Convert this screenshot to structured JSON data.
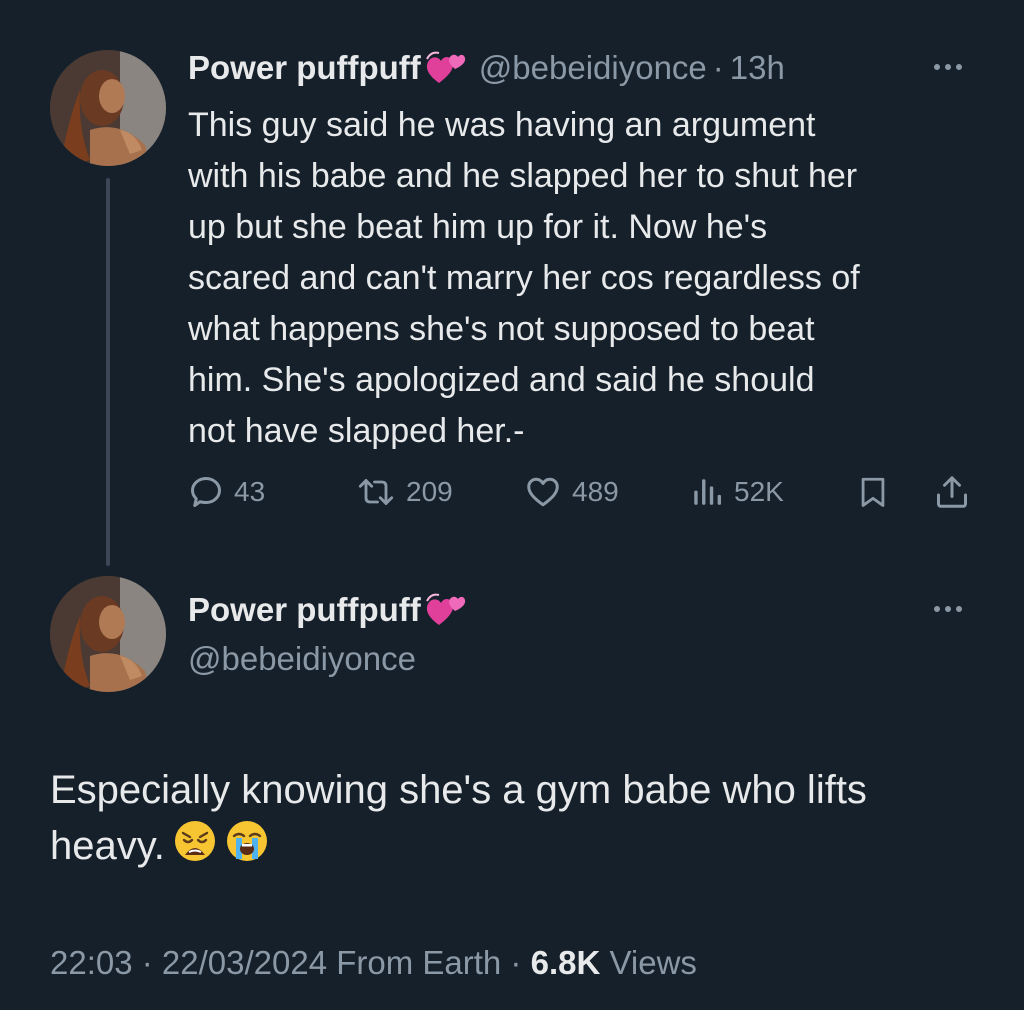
{
  "tweet1": {
    "avatar": "profile-photo",
    "name": "Power puffpuff",
    "name_emoji": "💞",
    "handle": "@bebeidiyonce",
    "separator": "·",
    "time": "13h",
    "text": "This guy said he was having an argument\nwith his babe and he slapped her to shut her\nup but she beat him up for it. Now he's\nscared and can't marry her cos regardless of\nwhat happens she's not supposed to beat\nhim. She's apologized and said he should\nnot have slapped her.-",
    "actions": {
      "replies": "43",
      "reposts": "209",
      "likes": "489",
      "views": "52K"
    },
    "icons": [
      "reply-icon",
      "repost-icon",
      "like-icon",
      "views-icon",
      "bookmark-icon",
      "share-icon",
      "more-icon"
    ]
  },
  "tweet2": {
    "avatar": "profile-photo",
    "name": "Power puffpuff",
    "name_emoji": "💞",
    "handle": "@bebeidiyonce",
    "text": "Especially knowing she's a gym babe who lifts\nheavy.",
    "emojis": [
      "weary-face",
      "loudly-crying-face"
    ],
    "timestamp": "22:03 · 22/03/2024 From Earth · ",
    "views_count": "6.8K",
    "views_label": " Views"
  },
  "colors": {
    "background": "#15202b",
    "primary_text": "#e7e9ea",
    "secondary_text": "#8b98a5",
    "thread_line": "#3c4654"
  }
}
